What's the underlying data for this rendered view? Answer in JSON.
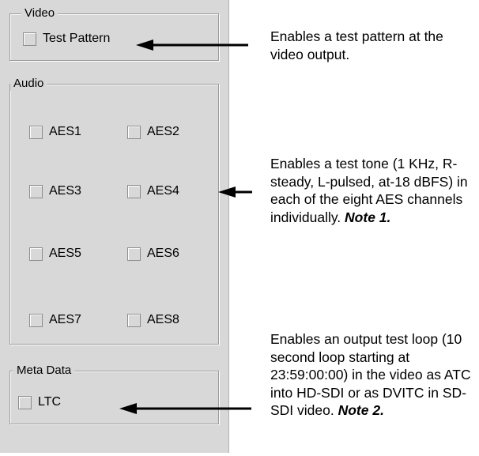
{
  "video": {
    "title": "Video",
    "test_pattern_label": "Test Pattern",
    "test_pattern_checked": false
  },
  "audio": {
    "title": "Audio",
    "channels": [
      {
        "label": "AES1",
        "checked": false
      },
      {
        "label": "AES2",
        "checked": false
      },
      {
        "label": "AES3",
        "checked": false
      },
      {
        "label": "AES4",
        "checked": false
      },
      {
        "label": "AES5",
        "checked": false
      },
      {
        "label": "AES6",
        "checked": false
      },
      {
        "label": "AES7",
        "checked": false
      },
      {
        "label": "AES8",
        "checked": false
      }
    ]
  },
  "meta": {
    "title": "Meta Data",
    "ltc_label": "LTC",
    "ltc_checked": false
  },
  "annotations": {
    "video": "Enables a test pattern at the video output.",
    "audio": {
      "text": "Enables a test tone  (1 KHz, R-steady, L-pulsed, at-18 dBFS) in each of the eight AES channels individually.",
      "note": "Note 1."
    },
    "meta": {
      "text": "Enables an output test loop (10 second loop starting at 23:59:00:00) in the video as ATC into HD-SDI or as DVITC in SD-SDI video.",
      "note": "Note 2."
    }
  },
  "colors": {
    "panel": "#d8d8d8",
    "arrow": "#000000"
  }
}
